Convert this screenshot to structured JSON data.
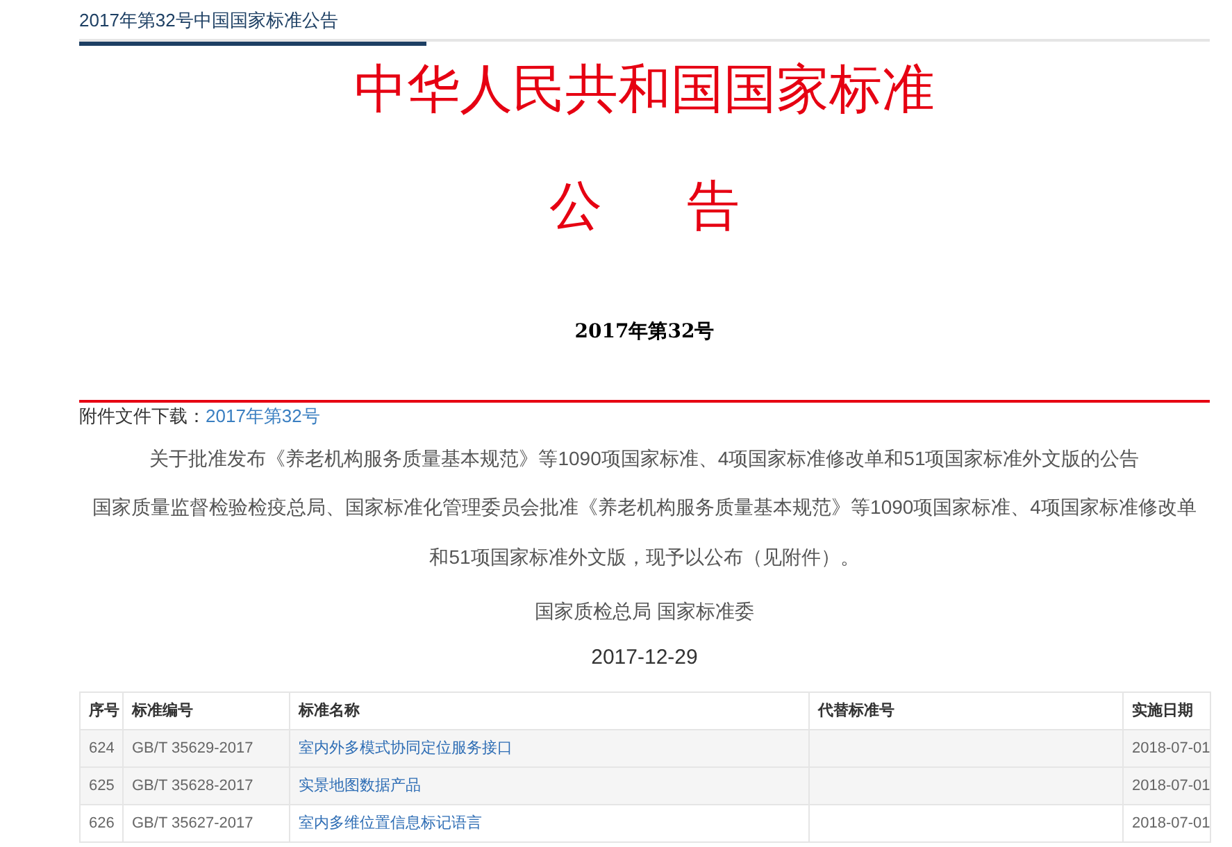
{
  "header": {
    "title": "2017年第32号中国国家标准公告"
  },
  "announcement": {
    "heading": "中华人民共和国国家标准",
    "subheading": "公告",
    "number": "2017年第32号"
  },
  "attachment": {
    "label": "附件文件下载：",
    "link": "2017年第32号"
  },
  "body": {
    "summary": "关于批准发布《养老机构服务质量基本规范》等1090项国家标准、4项国家标准修改单和51项国家标准外文版的公告",
    "paragraph": "国家质量监督检验检疫总局、国家标准化管理委员会批准《养老机构服务质量基本规范》等1090项国家标准、4项国家标准修改单和51项国家标准外文版，现予以公布（见附件）。",
    "issuer": "国家质检总局 国家标准委",
    "date": "2017-12-29"
  },
  "table": {
    "columns": [
      "序号",
      "标准编号",
      "标准名称",
      "代替标准号",
      "实施日期"
    ],
    "rows": [
      {
        "no": "624",
        "code": "GB/T 35629-2017",
        "name": "室内外多模式协同定位服务接口",
        "date": "2018-07-01"
      },
      {
        "no": "625",
        "code": "GB/T 35628-2017",
        "name": "实景地图数据产品",
        "date": "2018-07-01"
      },
      {
        "no": "626",
        "code": "GB/T 35627-2017",
        "name": "室内多维位置信息标记语言",
        "date": "2018-07-01"
      }
    ]
  }
}
